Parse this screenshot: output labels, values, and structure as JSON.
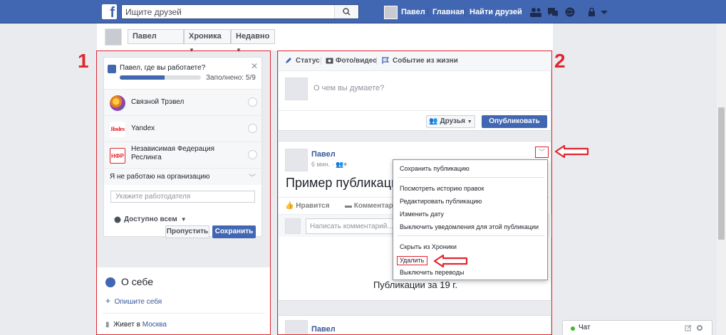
{
  "topbar": {
    "logo": "f",
    "search_placeholder": "Ищите друзей",
    "user_name": "Павел",
    "home": "Главная",
    "find_friends": "Найти друзей"
  },
  "profile_bar": {
    "name": "Павел",
    "timeline": "Хроника",
    "recent": "Недавно"
  },
  "annotations": {
    "label1": "1",
    "label2": "2"
  },
  "work_card": {
    "question": "Павел, где вы работаете?",
    "progress_text": "Заполнено: 5/9",
    "progress_value": 0.556,
    "companies": [
      "Связной Трэвел",
      "Yandex",
      "Независимая Федерация Реслинга"
    ],
    "yandex_logo": "Яndex",
    "nfr_logo": "НФР",
    "no_work": "Я не работаю на организацию",
    "employer_placeholder": "Укажите работодателя",
    "privacy": "Доступно всем",
    "skip": "Пропустить",
    "save": "Сохранить"
  },
  "about": {
    "title": "О себе",
    "add": "Опишите себя",
    "lives_prefix": "Живет в",
    "city": "Москва"
  },
  "composer": {
    "tab_status": "Статус",
    "tab_photo": "Фото/видео",
    "tab_event": "Событие из жизни",
    "placeholder": "О чем вы думаете?",
    "audience": "Друзья",
    "publish": "Опубликовать"
  },
  "post": {
    "author": "Павел",
    "time": "6 мин.",
    "text": "Пример публикации",
    "like": "Нравится",
    "comment": "Комментарий",
    "comment_placeholder": "Написать комментарий...",
    "year_label": "Публикации за 19   г.",
    "author2": "Павел"
  },
  "dropdown": {
    "items": [
      "Сохранить публикацию",
      "Посмотреть историю правок",
      "Редактировать публикацию",
      "Изменить дату",
      "Выключить уведомления для этой публикации",
      "Скрыть из Хроники",
      "Удалить",
      "Выключить переводы"
    ]
  },
  "chat": {
    "label": "Чат"
  },
  "colors": {
    "brand": "#4267b2",
    "annotation_red": "#e0262f"
  }
}
